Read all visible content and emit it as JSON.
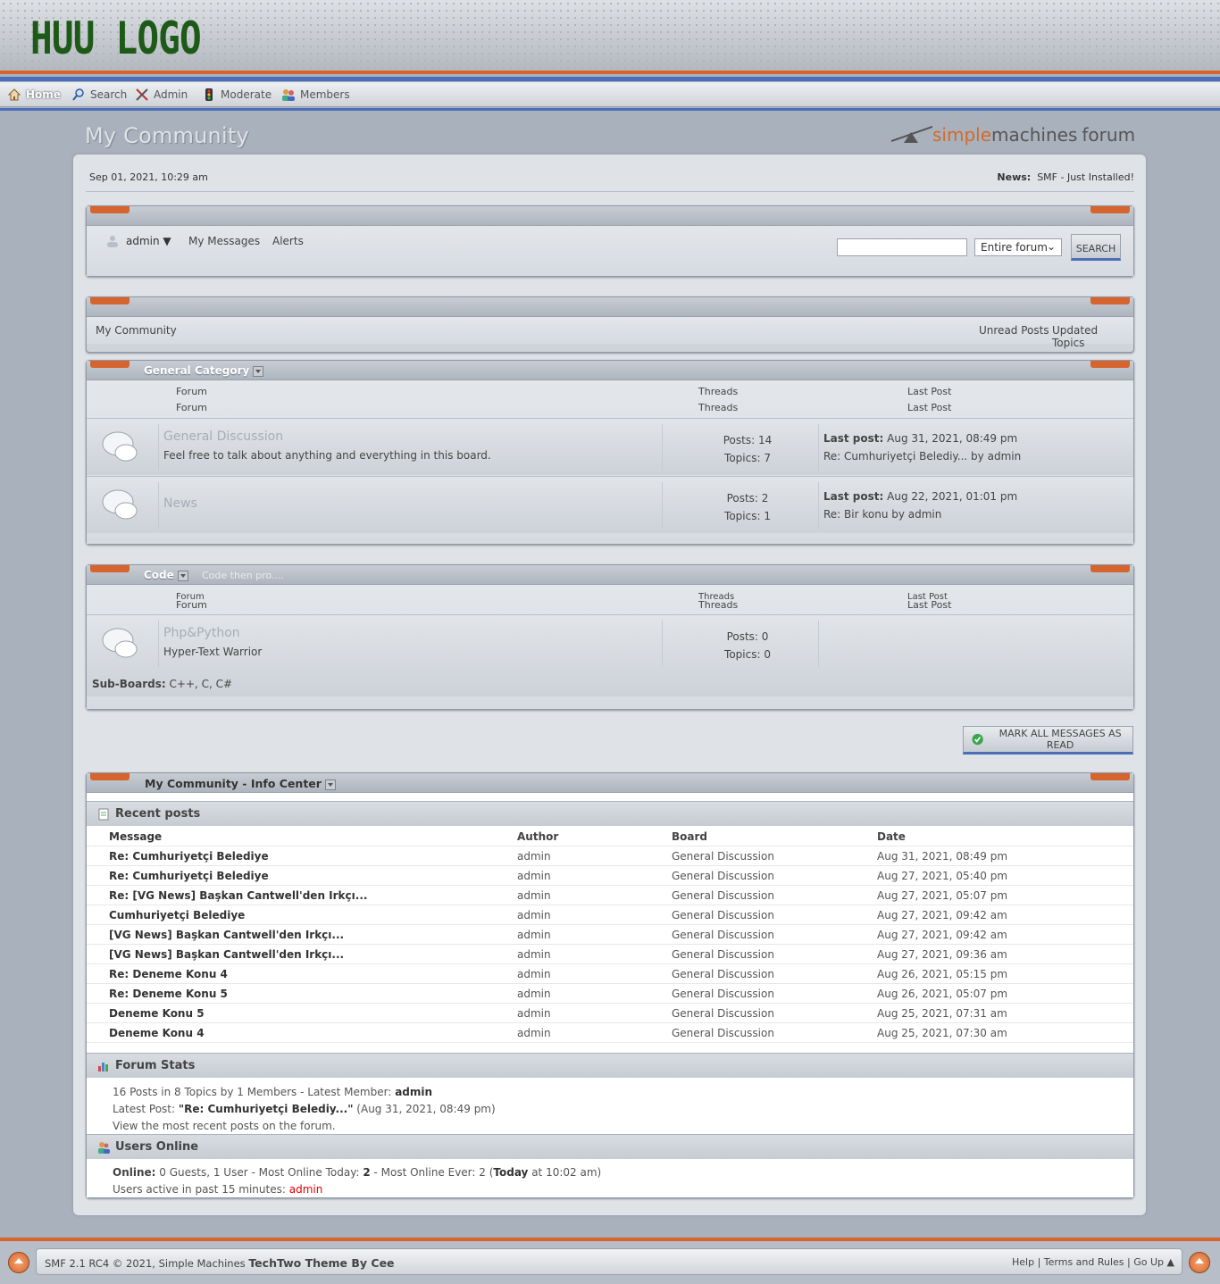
{
  "logo_text": "HUU LOGO",
  "nav": {
    "home": "Home",
    "search": "Search",
    "admin": "Admin",
    "moderate": "Moderate",
    "members": "Members"
  },
  "site_title": "My Community",
  "smf_logo": {
    "part1": "simple",
    "part2": "machines",
    "part3": "forum"
  },
  "date": "Sep 01, 2021, 10:29 am",
  "news_label": "News:",
  "news_text": "SMF - Just Installed!",
  "user_menu": {
    "user": "admin ▼",
    "messages": "My Messages",
    "alerts": "Alerts"
  },
  "search": {
    "value": "",
    "scope": "Entire forum",
    "button": "SEARCH"
  },
  "linktree": {
    "crumb": "My Community",
    "unread": "Unread Posts",
    "updated": "Updated Topics"
  },
  "categories": [
    {
      "title": "General Category",
      "desc": "",
      "col_forum": "Forum",
      "col_threads": "Threads",
      "col_last": "Last Post",
      "boards": [
        {
          "name": "General Discussion",
          "desc": "Feel free to talk about anything and everything in this board.",
          "posts": "Posts: 14",
          "topics": "Topics: 7",
          "last_label": "Last post:",
          "last_date": "Aug 31, 2021, 08:49 pm",
          "last_topic": "Re: Cumhuriyetçi Belediy... by admin"
        },
        {
          "name": "News",
          "desc": "",
          "posts": "Posts: 2",
          "topics": "Topics: 1",
          "last_label": "Last post:",
          "last_date": "Aug 22, 2021, 01:01 pm",
          "last_topic": "Re: Bir konu by admin"
        }
      ]
    },
    {
      "title": "Code",
      "desc": "Code then pro....",
      "col_forum": "Forum",
      "col_threads": "Threads",
      "col_last": "Last Post",
      "boards": [
        {
          "name": "Php&Python",
          "desc": "Hyper-Text Warrior",
          "posts": "Posts: 0",
          "topics": "Topics: 0",
          "subboards_label": "Sub-Boards:",
          "subboards": "C++, C, C#"
        }
      ]
    }
  ],
  "mark_read": "MARK ALL MESSAGES AS READ",
  "info": {
    "title": "My Community - Info Center",
    "recent_title": "Recent posts",
    "recent_headers": [
      "Message",
      "Author",
      "Board",
      "Date"
    ],
    "recent": [
      [
        "Re: Cumhuriyetçi Belediye",
        "admin",
        "General Discussion",
        "Aug 31, 2021, 08:49 pm"
      ],
      [
        "Re: Cumhuriyetçi Belediye",
        "admin",
        "General Discussion",
        "Aug 27, 2021, 05:40 pm"
      ],
      [
        "Re: [VG News] Başkan Cantwell'den Irkçı...",
        "admin",
        "General Discussion",
        "Aug 27, 2021, 05:07 pm"
      ],
      [
        "Cumhuriyetçi Belediye",
        "admin",
        "General Discussion",
        "Aug 27, 2021, 09:42 am"
      ],
      [
        "[VG News] Başkan Cantwell'den Irkçı...",
        "admin",
        "General Discussion",
        "Aug 27, 2021, 09:42 am"
      ],
      [
        "[VG News] Başkan Cantwell'den Irkçı...",
        "admin",
        "General Discussion",
        "Aug 27, 2021, 09:36 am"
      ],
      [
        "Re: Deneme Konu 4",
        "admin",
        "General Discussion",
        "Aug 26, 2021, 05:15 pm"
      ],
      [
        "Re: Deneme Konu 5",
        "admin",
        "General Discussion",
        "Aug 26, 2021, 05:07 pm"
      ],
      [
        "Deneme Konu 5",
        "admin",
        "General Discussion",
        "Aug 25, 2021, 07:31 am"
      ],
      [
        "Deneme Konu 4",
        "admin",
        "General Discussion",
        "Aug 25, 2021, 07:30 am"
      ]
    ],
    "stats_title": "Forum Stats",
    "stats_line1": "16 Posts in 8 Topics by 1 Members - Latest Member:",
    "stats_latest_member": "admin",
    "stats_line2_label": "Latest Post:",
    "stats_latest_post": "\"Re: Cumhuriyetçi Belediy...\"",
    "stats_latest_date": "(Aug 31, 2021, 08:49 pm)",
    "stats_line3": "View the most recent posts on the forum.",
    "online_title": "Users Online",
    "online_label": "Online:",
    "online_text": "0 Guests, 1 User  - Most Online Today:",
    "online_today": "2",
    "online_ever": " -  Most Online Ever: 2 (",
    "online_today_word": "Today",
    "online_time": " at 10:02 am)",
    "active_label": "Users active in past 15 minutes:",
    "active_user": "admin"
  },
  "footer": {
    "copyright": "SMF 2.1 RC4 © 2021, Simple Machines",
    "theme": "TechTwo Theme By Cee",
    "help": "Help",
    "terms": "Terms and Rules",
    "goup": "Go Up ▲"
  }
}
